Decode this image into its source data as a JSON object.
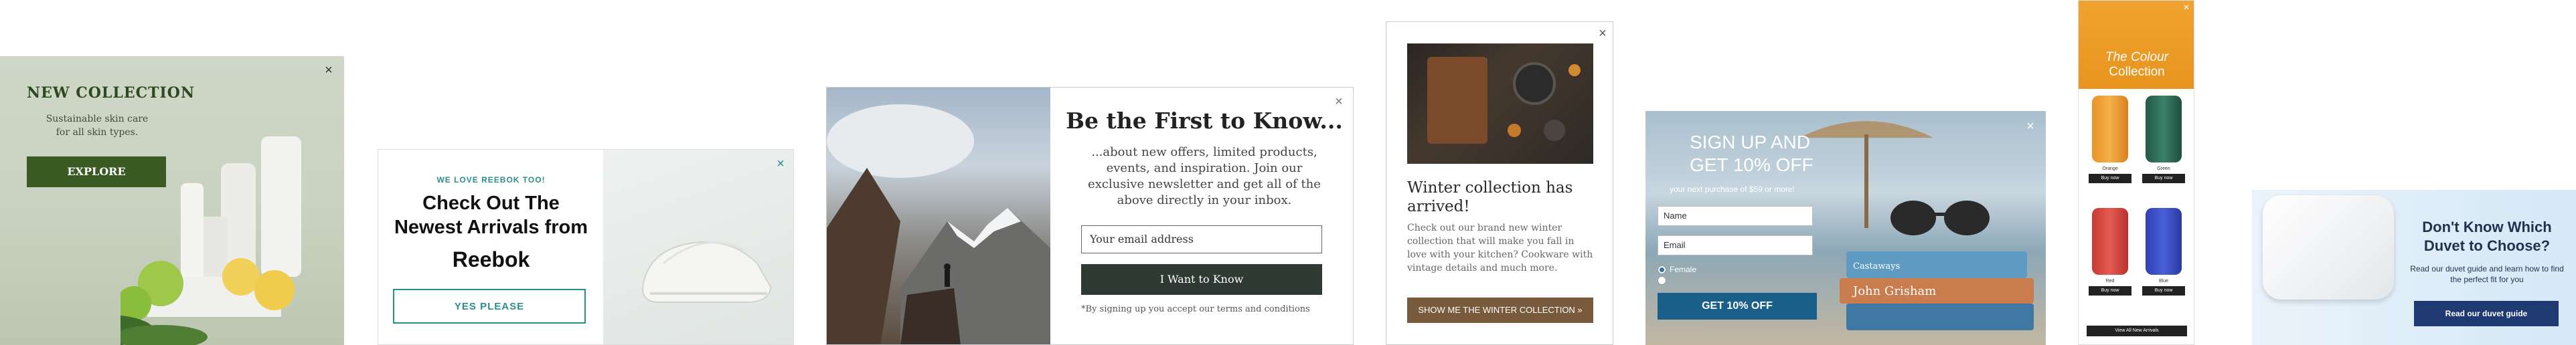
{
  "close_glyph": "×",
  "popup1": {
    "title": "NEW COLLECTION",
    "subtitle_line1": "Sustainable skin care",
    "subtitle_line2": "for all skin types.",
    "button": "EXPLORE",
    "colors": {
      "button": "#3a5a23",
      "title": "#2c4a1f"
    }
  },
  "popup2": {
    "kicker": "WE LOVE REEBOK TOO!",
    "heading": "Check Out The Newest Arrivals from",
    "brand": "Reebok",
    "button": "YES PLEASE",
    "colors": {
      "accent": "#2a8f8a"
    }
  },
  "popup3": {
    "heading": "Be the First to Know...",
    "body": "...about new offers, limited products, events, and inspiration. Join our exclusive newsletter and get all of the above directly in your inbox.",
    "email_placeholder": "Your email address",
    "button": "I Want to Know",
    "terms": "*By signing up you accept our terms and conditions"
  },
  "popup4": {
    "heading": "Winter collection has arrived!",
    "body": "Check out our brand new winter collection that will make you fall in love with your kitchen? Cookware with vintage details and much more.",
    "button": "SHOW ME THE WINTER COLLECTION »",
    "colors": {
      "button": "#7a5a3c"
    }
  },
  "popup5": {
    "heading_line1": "SIGN UP AND",
    "heading_line2": "GET 10% OFF",
    "tagline": "your next purchase of $59 or more!",
    "name_placeholder": "Name",
    "email_placeholder": "Email",
    "radio_female": "Female",
    "radio_male": "",
    "button": "GET 10% OFF",
    "colors": {
      "button": "#1a5f8a"
    }
  },
  "popup6": {
    "kicker": "",
    "heading_line1": "The Colour",
    "heading_line2": "Collection",
    "products": [
      {
        "name": "Orange",
        "price": "",
        "color": "#e8942a",
        "buy": "Buy now"
      },
      {
        "name": "Green",
        "price": "",
        "color": "#2f6e5a",
        "buy": "Buy now"
      },
      {
        "name": "Red",
        "price": "",
        "color": "#d9473f",
        "buy": "Buy now"
      },
      {
        "name": "Blue",
        "price": "",
        "color": "#3a4fc8",
        "buy": "Buy now"
      }
    ],
    "view_all": "View All New Arrivals",
    "colors": {
      "hero": "#f0a330"
    }
  },
  "popup7": {
    "heading": "Don't Know Which Duvet to Choose?",
    "body": "Read our duvet guide and learn how to find the perfect fit for you",
    "button": "Read our duvet guide",
    "colors": {
      "button": "#1f3a72"
    }
  }
}
